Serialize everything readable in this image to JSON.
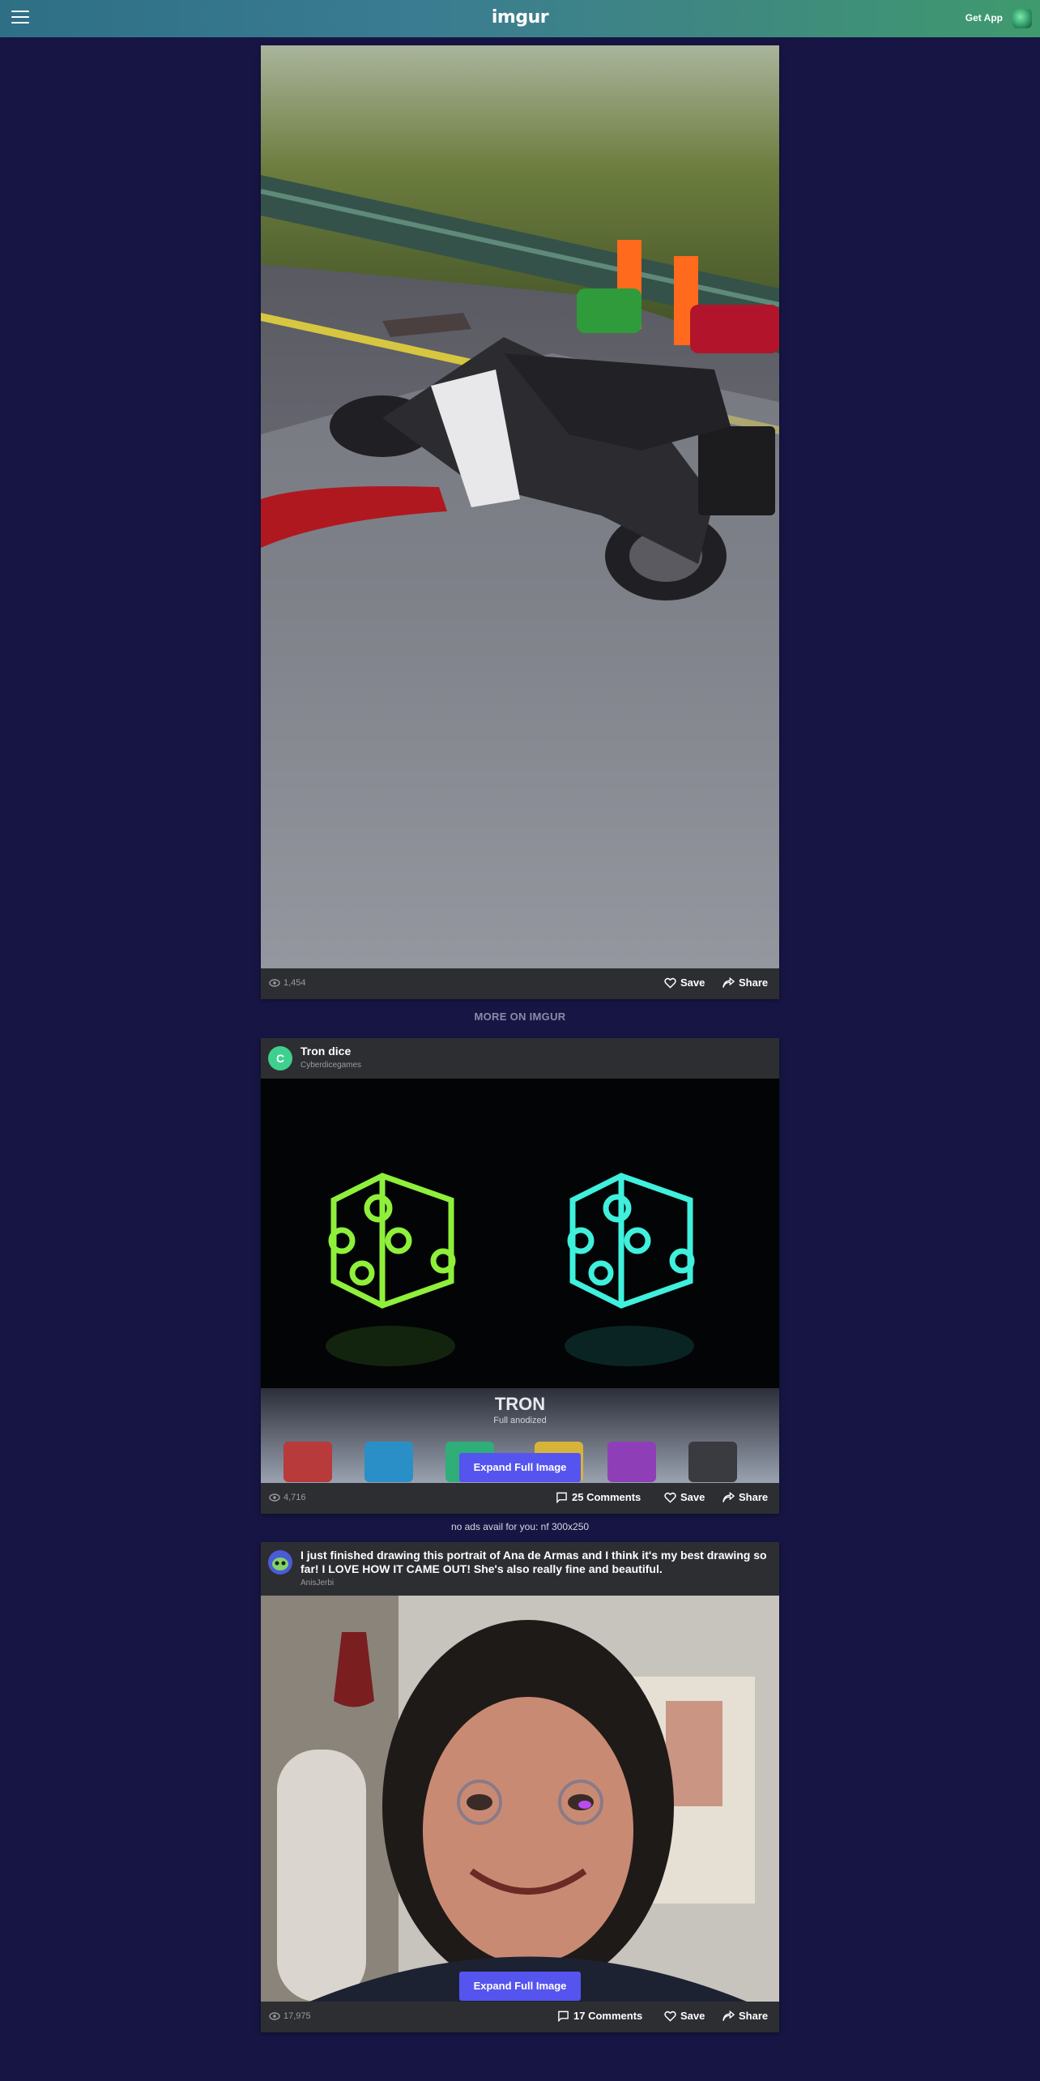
{
  "header": {
    "logo": "imgur",
    "get_app": "Get App",
    "icons": {
      "menu": "hamburger-menu-icon",
      "app": "app-logo-icon"
    }
  },
  "main_post": {
    "image_description_icon": "motorcycle-accident-photo",
    "views": "1,454",
    "save_label": "Save",
    "share_label": "Share"
  },
  "more_label": "MORE ON IMGUR",
  "feed": [
    {
      "title": "Tron dice",
      "author": "Cyberdicegames",
      "avatar_letter": "C",
      "banner_title": "TRON",
      "banner_subtitle": "Full anodized",
      "expand_label": "Expand Full Image",
      "views": "4,716",
      "comments": "25 Comments",
      "save_label": "Save",
      "share_label": "Share"
    },
    {
      "title": "I just finished drawing this portrait of Ana de Armas and I think it's my best drawing so far! I LOVE HOW IT CAME OUT! She's also really fine and beautiful.",
      "author": "AnisJerbi",
      "expand_label": "Expand Full Image",
      "views": "17,975",
      "comments": "17 Comments",
      "save_label": "Save",
      "share_label": "Share"
    }
  ],
  "ad_note": "no ads avail for you: nf 300x250",
  "colors": {
    "page_bg": "#171544",
    "card_bg": "#2d2e32",
    "button_blue": "#5554ef",
    "header_gradient_start": "#2e6f86",
    "header_gradient_end": "#3f9a6e"
  }
}
